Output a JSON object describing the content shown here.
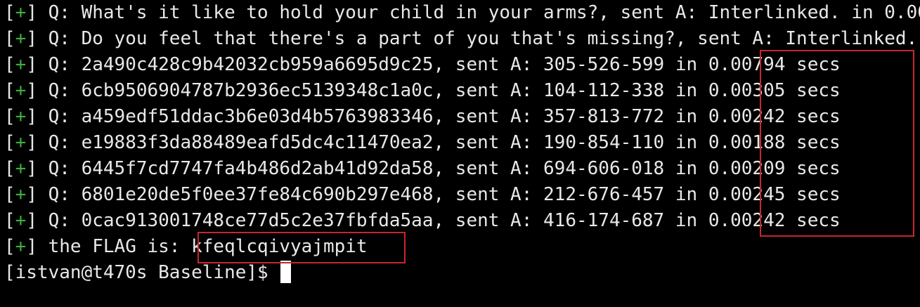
{
  "terminal": {
    "lines": [
      {
        "bracket_open": "[",
        "sign": "+",
        "bracket_close": "]",
        "text": " Q: What's it like to hold your child in your arms?, sent A: Interlinked. in 0.00"
      },
      {
        "bracket_open": "[",
        "sign": "+",
        "bracket_close": "]",
        "text": " Q: Do you feel that there's a part of you that's missing?, sent A: Interlinked."
      },
      {
        "bracket_open": "[",
        "sign": "+",
        "bracket_close": "]",
        "text": " Q: 2a490c428c9b42032cb959a6695d9c25, sent A: 305-526-599 in 0.00794 secs"
      },
      {
        "bracket_open": "[",
        "sign": "+",
        "bracket_close": "]",
        "text": " Q: 6cb9506904787b2936ec5139348c1a0c, sent A: 104-112-338 in 0.00305 secs"
      },
      {
        "bracket_open": "[",
        "sign": "+",
        "bracket_close": "]",
        "text": " Q: a459edf51ddac3b6e03d4b5763983346, sent A: 357-813-772 in 0.00242 secs"
      },
      {
        "bracket_open": "[",
        "sign": "+",
        "bracket_close": "]",
        "text": " Q: e19883f3da88489eafd5dc4c11470ea2, sent A: 190-854-110 in 0.00188 secs"
      },
      {
        "bracket_open": "[",
        "sign": "+",
        "bracket_close": "]",
        "text": " Q: 6445f7cd7747fa4b486d2ab41d92da58, sent A: 694-606-018 in 0.00209 secs"
      },
      {
        "bracket_open": "[",
        "sign": "+",
        "bracket_close": "]",
        "text": " Q: 6801e20de5f0ee37fe84c690b297e468, sent A: 212-676-457 in 0.00245 secs"
      },
      {
        "bracket_open": "[",
        "sign": "+",
        "bracket_close": "]",
        "text": " Q: 0cac913001748ce77d5c2e37fbfda5aa, sent A: 416-174-687 in 0.00242 secs"
      },
      {
        "bracket_open": "[",
        "sign": "+",
        "bracket_close": "]",
        "text": " the FLAG is: kfeqlcqivyajmpit"
      }
    ],
    "prompt": "[istvan@t470s Baseline]$ "
  },
  "colors": {
    "background": "#000000",
    "foreground": "#e8e8e8",
    "plus_sign": "#3fae3f",
    "highlight_border": "#c8262c",
    "cursor": "#ffffff"
  }
}
